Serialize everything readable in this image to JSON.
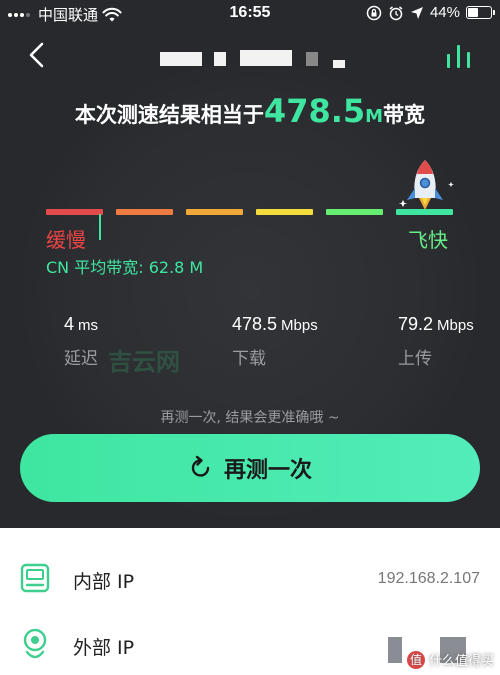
{
  "status_bar": {
    "carrier": "中国联通",
    "time": "16:55",
    "battery": "44%"
  },
  "headline": {
    "prefix": "本次测速结果相当于",
    "value": "478.5",
    "unit": "M",
    "suffix": "带宽"
  },
  "scale": {
    "colors": [
      "#e24b4b",
      "#ee7c40",
      "#f0a838",
      "#f4dc3c",
      "#66ee70",
      "#3ee6a0"
    ],
    "slow_label": "缓慢",
    "fast_label": "飞快",
    "average": "CN 平均带宽: 62.8 M"
  },
  "stats": [
    {
      "value": "4",
      "unit": "ms",
      "label": "延迟"
    },
    {
      "value": "478.5",
      "unit": "Mbps",
      "label": "下载"
    },
    {
      "value": "79.2",
      "unit": "Mbps",
      "label": "上传"
    }
  ],
  "watermark": "吉云网",
  "hint": "再测一次, 结果会更准确哦 ~",
  "retest_label": "再测一次",
  "info_rows": [
    {
      "label": "内部 IP",
      "value": "192.168.2.107"
    },
    {
      "label": "外部 IP",
      "value": ""
    }
  ],
  "corner_watermark": "什么值得买",
  "accent": "#3ee6a0"
}
